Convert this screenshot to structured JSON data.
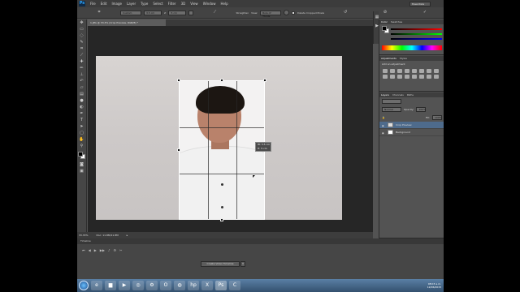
{
  "app": {
    "logo": "Ps",
    "menu": [
      "File",
      "Edit",
      "Image",
      "Layer",
      "Type",
      "Select",
      "Filter",
      "3D",
      "View",
      "Window",
      "Help"
    ],
    "workspace": "Essentials"
  },
  "options": {
    "ratio": "Custom",
    "width": "3.5 cm",
    "height": "5 cm",
    "straighten_label": "Straighten",
    "view_label": "View:",
    "view_value": "Rule of Thirds",
    "delete_cropped_label": "Delete Cropped Pixels"
  },
  "document": {
    "tab_title": "1.JPG @ 33.3% (Crop Preview, RGB/8) *",
    "tooltip_w": "W: 3.5 cm",
    "tooltip_h": "H: 5 cm"
  },
  "status": {
    "zoom": "33.33%",
    "doc_size": "Doc: 11.8M/11.8M"
  },
  "timeline": {
    "tab_label": "Timeline",
    "create_button": "Create Video Timeline",
    "arrow": "▾"
  },
  "panels": {
    "color_tabs": [
      "Color",
      "Swatches"
    ],
    "adjust_tabs": [
      "Adjustments",
      "Styles"
    ],
    "add_adjustment": "Add an adjustment",
    "layers_tabs": [
      "Layers",
      "Channels",
      "Paths"
    ],
    "blend_mode": "Normal",
    "opacity_label": "Opacity:",
    "opacity_value": "100%",
    "fill_label": "Fill:",
    "fill_value": "100%",
    "layers": [
      {
        "name": "Crop Preview",
        "selected": true
      },
      {
        "name": "Background",
        "selected": false
      }
    ]
  },
  "taskbar": {
    "icons": [
      "start",
      "ie-icon",
      "folder-icon",
      "media-icon",
      "chrome-icon",
      "settings-icon",
      "opera-icon",
      "firefox-icon",
      "hp-icon",
      "excel-icon",
      "photoshop-icon",
      "camtasia-icon"
    ],
    "time": "08:03 a.m.",
    "date": "12/06/2015"
  },
  "colors": {
    "accent": "#31a8ff",
    "selected_layer": "#4e6b8c"
  }
}
